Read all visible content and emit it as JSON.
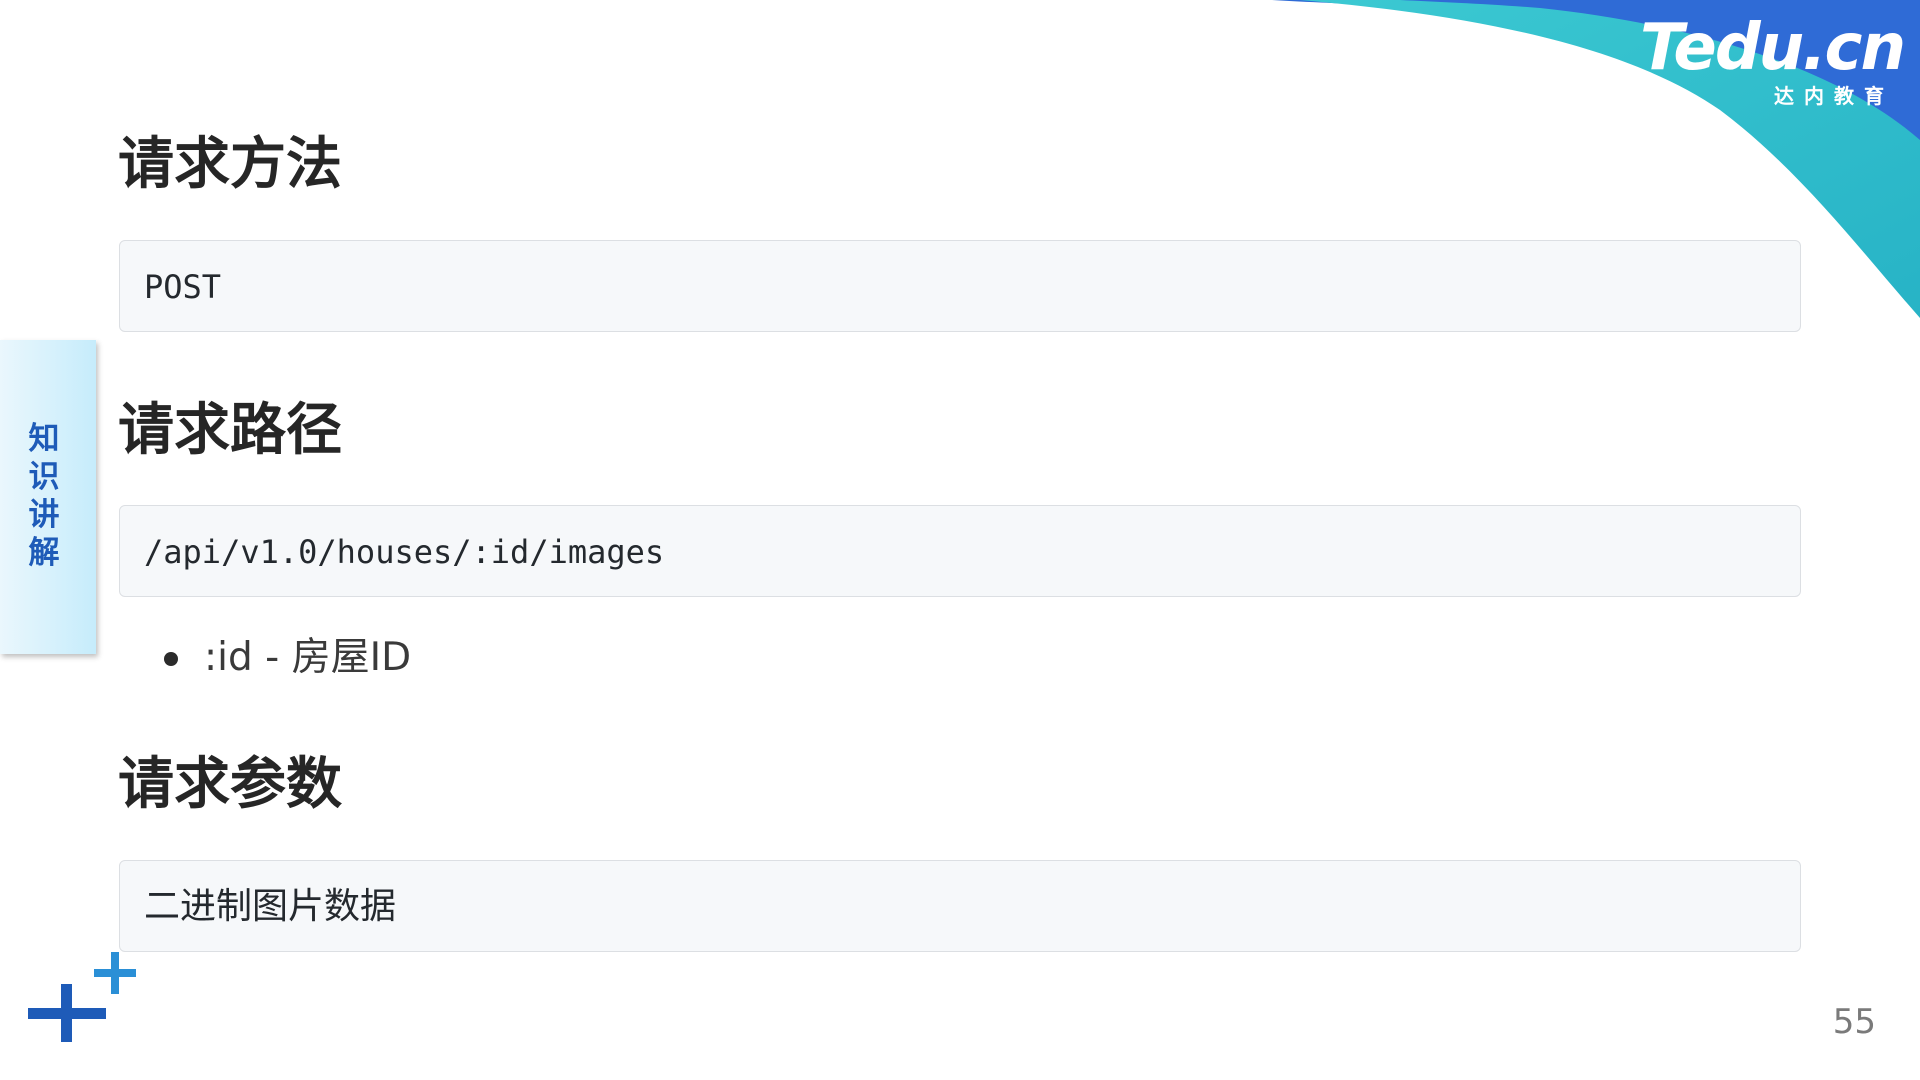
{
  "brand": {
    "logo_text": "Tedu.cn",
    "logo_subtitle": "达内教育"
  },
  "side_tab": {
    "label": "知识讲解"
  },
  "sections": [
    {
      "heading": "请求方法",
      "code": "POST"
    },
    {
      "heading": "请求路径",
      "code": "/api/v1.0/houses/:id/images",
      "bullets": [
        ":id - 房屋ID"
      ]
    },
    {
      "heading": "请求参数",
      "code": "二进制图片数据"
    }
  ],
  "page_number": "55",
  "colors": {
    "accent_blue": "#1e5bb8",
    "swoosh_dark_blue": "#2f6bd6",
    "swoosh_teal": "#2fbfcb",
    "code_background": "#f6f8fa",
    "code_border": "#dcdfe3",
    "heading_text": "#262626"
  },
  "icons": [
    "plus-icon-large",
    "plus-icon-small"
  ]
}
